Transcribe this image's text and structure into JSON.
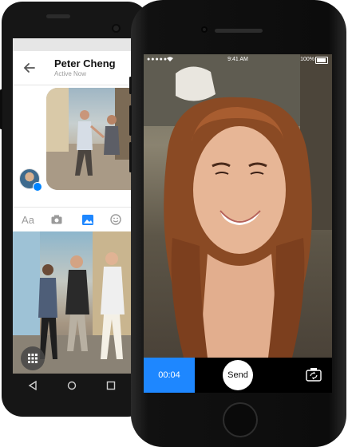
{
  "android": {
    "contact": {
      "name": "Peter Cheng",
      "status": "Active Now"
    },
    "composer": {
      "text_label": "Aa"
    }
  },
  "iphone": {
    "status_bar": {
      "signal": "●●●●●",
      "time": "9:41 AM",
      "battery": "100%"
    },
    "camera": {
      "timer": "00:04",
      "send_label": "Send"
    }
  },
  "colors": {
    "accent": "#1e87ff",
    "messenger_blue": "#0084ff"
  }
}
